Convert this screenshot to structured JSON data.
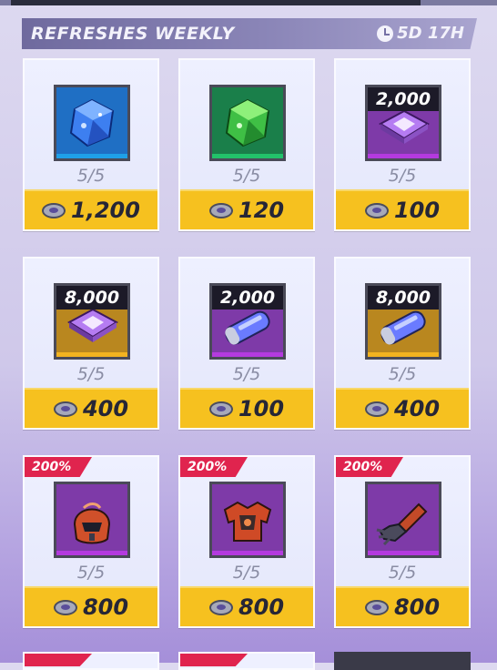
{
  "header": {
    "title": "REFRESHES WEEKLY",
    "timer": "5D 17H"
  },
  "colors": {
    "price_bg": "#f6c11f",
    "badge_bg": "#e0244e",
    "header_bg": "#7570a5"
  },
  "items": [
    {
      "icon": "blue-cube-icon",
      "quantity": "",
      "count": "5/5",
      "price": "1,200",
      "badge": ""
    },
    {
      "icon": "green-cube-icon",
      "quantity": "",
      "count": "5/5",
      "price": "120",
      "badge": ""
    },
    {
      "icon": "purple-chip-icon",
      "quantity": "2,000",
      "count": "5/5",
      "price": "100",
      "badge": ""
    },
    {
      "icon": "purple-chip-icon",
      "quantity": "8,000",
      "count": "5/5",
      "price": "400",
      "badge": ""
    },
    {
      "icon": "capsule-icon",
      "quantity": "2,000",
      "count": "5/5",
      "price": "100",
      "badge": ""
    },
    {
      "icon": "capsule-icon",
      "quantity": "8,000",
      "count": "5/5",
      "price": "400",
      "badge": ""
    },
    {
      "icon": "helmet-icon",
      "quantity": "",
      "count": "5/5",
      "price": "800",
      "badge": "200%"
    },
    {
      "icon": "chest-armor-icon",
      "quantity": "",
      "count": "5/5",
      "price": "800",
      "badge": "200%"
    },
    {
      "icon": "gauntlet-icon",
      "quantity": "",
      "count": "5/5",
      "price": "800",
      "badge": "200%"
    }
  ]
}
